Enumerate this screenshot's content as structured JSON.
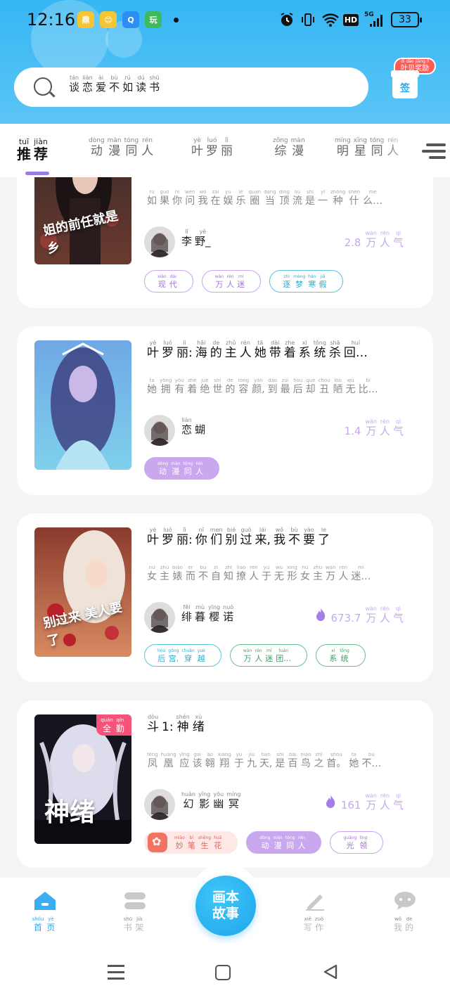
{
  "status_bar": {
    "time": "12:16",
    "apps": [
      {
        "icon": "xiaomi-app-icon",
        "label": "鼎",
        "color": "#f5c533"
      },
      {
        "icon": "emoji-app-icon",
        "label": "😊",
        "color": "#f5c533"
      },
      {
        "icon": "qq-browser-icon",
        "label": "Q",
        "color": "#2c8df3"
      },
      {
        "icon": "game-app-icon",
        "label": "玩",
        "color": "#3dbb5c"
      }
    ],
    "network_label": "HD",
    "signal_label": "5G",
    "battery": "33"
  },
  "search": {
    "placeholder": [
      {
        "p": "tán",
        "c": "谈"
      },
      {
        "p": "liàn",
        "c": "恋"
      },
      {
        "p": "ài",
        "c": "爱"
      },
      {
        "p": "bù",
        "c": "不"
      },
      {
        "p": "rú",
        "c": "如"
      },
      {
        "p": "dú",
        "c": "读"
      },
      {
        "p": "shū",
        "c": "书"
      }
    ]
  },
  "sign_in": {
    "badge": [
      {
        "p": "yè",
        "c": "叶"
      },
      {
        "p": "luó",
        "c": "罗"
      },
      {
        "p": "lì",
        "c": "丽"
      },
      {
        "p": "dì",
        "c": "?"
      }
    ],
    "badge_text": "叶贝奖励",
    "badge_pinyin": "dì dǎo jiǎng lì",
    "label": "签"
  },
  "tabs": [
    {
      "name": "tab-recommend",
      "active": true,
      "chars": [
        {
          "p": "tuī",
          "c": "推"
        },
        {
          "p": "jiàn",
          "c": "荐"
        }
      ]
    },
    {
      "name": "tab-anime-fan",
      "active": false,
      "chars": [
        {
          "p": "dòng",
          "c": "动"
        },
        {
          "p": "màn",
          "c": "漫"
        },
        {
          "p": "tóng",
          "c": "同"
        },
        {
          "p": "rén",
          "c": "人"
        }
      ]
    },
    {
      "name": "tab-yeluoli",
      "active": false,
      "chars": [
        {
          "p": "yè",
          "c": "叶"
        },
        {
          "p": "luó",
          "c": "罗"
        },
        {
          "p": "lì",
          "c": "丽"
        }
      ]
    },
    {
      "name": "tab-variety",
      "active": false,
      "chars": [
        {
          "p": "zōng",
          "c": "综"
        },
        {
          "p": "màn",
          "c": "漫"
        }
      ]
    },
    {
      "name": "tab-star-fan",
      "active": false,
      "chars": [
        {
          "p": "míng",
          "c": "明"
        },
        {
          "p": "xīng",
          "c": "星"
        },
        {
          "p": "tóng",
          "c": "同"
        },
        {
          "p": "rén",
          "c": "人"
        }
      ]
    }
  ],
  "stories": [
    {
      "cover_text": "姐的前任就是乡",
      "title": [],
      "desc": [
        {
          "p": "rú",
          "c": "如"
        },
        {
          "p": "guǒ",
          "c": "果"
        },
        {
          "p": "nǐ",
          "c": "你"
        },
        {
          "p": "wèn",
          "c": "问"
        },
        {
          "p": "wǒ",
          "c": "我"
        },
        {
          "p": "zài",
          "c": "在"
        },
        {
          "p": "yú",
          "c": "娱"
        },
        {
          "p": "lè",
          "c": "乐"
        },
        {
          "p": "quān",
          "c": "圈"
        },
        {
          "p": "dāng",
          "c": "当"
        },
        {
          "p": "dǐng",
          "c": "顶"
        },
        {
          "p": "liú",
          "c": "流"
        },
        {
          "p": "shì",
          "c": "是"
        },
        {
          "p": "yī",
          "c": "一"
        },
        {
          "p": "zhǒng",
          "c": "种"
        },
        {
          "p": "shén",
          "c": "什"
        },
        {
          "p": "me",
          "c": "么…"
        }
      ],
      "author": [
        {
          "p": "lǐ",
          "c": "李"
        },
        {
          "p": "yě",
          "c": "野_"
        }
      ],
      "heat_num": "2.8",
      "heat_unit": [
        {
          "p": "wàn",
          "c": "万"
        },
        {
          "p": "rén",
          "c": "人"
        },
        {
          "p": "qì",
          "c": "气"
        }
      ],
      "hot": false,
      "chips": [
        {
          "style": "purple",
          "chars": [
            {
              "p": "xiàn",
              "c": "现"
            },
            {
              "p": "dài",
              "c": "代"
            }
          ]
        },
        {
          "style": "purple",
          "chars": [
            {
              "p": "wàn",
              "c": "万"
            },
            {
              "p": "rén",
              "c": "人"
            },
            {
              "p": "mí",
              "c": "迷"
            }
          ]
        },
        {
          "style": "cyan",
          "chars": [
            {
              "p": "zhì",
              "c": "逐"
            },
            {
              "p": "mèng",
              "c": "梦"
            },
            {
              "p": "hán",
              "c": "寒"
            },
            {
              "p": "jiǎ",
              "c": "假"
            }
          ]
        }
      ]
    },
    {
      "cover_text": "",
      "title": [
        {
          "p": "yè",
          "c": "叶"
        },
        {
          "p": "luó",
          "c": "罗"
        },
        {
          "p": "lì",
          "c": "丽:"
        },
        {
          "p": "hǎi",
          "c": "海"
        },
        {
          "p": "de",
          "c": "的"
        },
        {
          "p": "zhǔ",
          "c": "主"
        },
        {
          "p": "rén",
          "c": "人"
        },
        {
          "p": "tā",
          "c": "她"
        },
        {
          "p": "dài",
          "c": "带"
        },
        {
          "p": "zhe",
          "c": "着"
        },
        {
          "p": "xì",
          "c": "系"
        },
        {
          "p": "tǒng",
          "c": "统"
        },
        {
          "p": "shā",
          "c": "杀"
        },
        {
          "p": "huí",
          "c": "回…"
        }
      ],
      "desc": [
        {
          "p": "tā",
          "c": "她"
        },
        {
          "p": "yōng",
          "c": "拥"
        },
        {
          "p": "yǒu",
          "c": "有"
        },
        {
          "p": "zhe",
          "c": "着"
        },
        {
          "p": "jué",
          "c": "绝"
        },
        {
          "p": "shì",
          "c": "世"
        },
        {
          "p": "de",
          "c": "的"
        },
        {
          "p": "róng",
          "c": "容"
        },
        {
          "p": "yán",
          "c": "颜,"
        },
        {
          "p": "dào",
          "c": "到"
        },
        {
          "p": "zuì",
          "c": "最"
        },
        {
          "p": "hòu",
          "c": "后"
        },
        {
          "p": "què",
          "c": "却"
        },
        {
          "p": "chǒu",
          "c": "丑"
        },
        {
          "p": "lòu",
          "c": "陋"
        },
        {
          "p": "wú",
          "c": "无"
        },
        {
          "p": "bǐ",
          "c": "比…"
        }
      ],
      "author": [
        {
          "p": "liàn",
          "c": "恋"
        },
        {
          "p": "",
          "c": "蝴"
        }
      ],
      "heat_num": "1.4",
      "heat_unit": [
        {
          "p": "wàn",
          "c": "万"
        },
        {
          "p": "rén",
          "c": "人"
        },
        {
          "p": "qì",
          "c": "气"
        }
      ],
      "hot": false,
      "chips": [
        {
          "style": "solid-purple",
          "chars": [
            {
              "p": "dòng",
              "c": "动"
            },
            {
              "p": "màn",
              "c": "漫"
            },
            {
              "p": "tóng",
              "c": "同"
            },
            {
              "p": "rén",
              "c": "人"
            }
          ]
        }
      ]
    },
    {
      "cover_text": "别过来 美人要了",
      "title": [
        {
          "p": "yè",
          "c": "叶"
        },
        {
          "p": "luó",
          "c": "罗"
        },
        {
          "p": "lì",
          "c": "丽:"
        },
        {
          "p": "nǐ",
          "c": "你"
        },
        {
          "p": "men",
          "c": "们"
        },
        {
          "p": "bié",
          "c": "别"
        },
        {
          "p": "guò",
          "c": "过"
        },
        {
          "p": "lái",
          "c": "来,"
        },
        {
          "p": "wǒ",
          "c": "我"
        },
        {
          "p": "bù",
          "c": "不"
        },
        {
          "p": "yào",
          "c": "要"
        },
        {
          "p": "le",
          "c": "了"
        }
      ],
      "desc": [
        {
          "p": "nǚ",
          "c": "女"
        },
        {
          "p": "zhǔ",
          "c": "主"
        },
        {
          "p": "biǎo",
          "c": "婊"
        },
        {
          "p": "ér",
          "c": "而"
        },
        {
          "p": "bù",
          "c": "不"
        },
        {
          "p": "zì",
          "c": "自"
        },
        {
          "p": "zhī",
          "c": "知"
        },
        {
          "p": "liáo",
          "c": "撩"
        },
        {
          "p": "rén",
          "c": "人"
        },
        {
          "p": "yú",
          "c": "于"
        },
        {
          "p": "wú",
          "c": "无"
        },
        {
          "p": "xíng",
          "c": "形"
        },
        {
          "p": "nǚ",
          "c": "女"
        },
        {
          "p": "zhǔ",
          "c": "主"
        },
        {
          "p": "wàn",
          "c": "万"
        },
        {
          "p": "rén",
          "c": "人"
        },
        {
          "p": "mí",
          "c": "迷…"
        }
      ],
      "author": [
        {
          "p": "fēi",
          "c": "绯"
        },
        {
          "p": "mù",
          "c": "暮"
        },
        {
          "p": "yīng",
          "c": "樱"
        },
        {
          "p": "nuò",
          "c": "诺"
        }
      ],
      "heat_num": "673.7",
      "heat_unit": [
        {
          "p": "wàn",
          "c": "万"
        },
        {
          "p": "rén",
          "c": "人"
        },
        {
          "p": "qì",
          "c": "气"
        }
      ],
      "hot": true,
      "chips": [
        {
          "style": "cyan",
          "chars": [
            {
              "p": "hòu",
              "c": "后"
            },
            {
              "p": "gōng",
              "c": "宫,"
            },
            {
              "p": "chuān",
              "c": "穿"
            },
            {
              "p": "yuè",
              "c": "越"
            }
          ]
        },
        {
          "style": "green",
          "chars": [
            {
              "p": "wàn",
              "c": "万"
            },
            {
              "p": "rén",
              "c": "人"
            },
            {
              "p": "mí",
              "c": "迷"
            },
            {
              "p": "tuán",
              "c": "团…"
            }
          ]
        },
        {
          "style": "green",
          "chars": [
            {
              "p": "xì",
              "c": "系"
            },
            {
              "p": "tǒng",
              "c": "统"
            }
          ]
        }
      ]
    },
    {
      "cover_text": "神绪",
      "cover_tag": [
        {
          "p": "quán",
          "c": "全"
        },
        {
          "p": "qín",
          "c": "勤"
        }
      ],
      "title": [
        {
          "p": "dòu",
          "c": "斗"
        },
        {
          "p": "",
          "c": "1:"
        },
        {
          "p": "shén",
          "c": "神"
        },
        {
          "p": "xù",
          "c": "绪"
        }
      ],
      "desc": [
        {
          "p": "fèng",
          "c": "凤"
        },
        {
          "p": "huáng",
          "c": "凰"
        },
        {
          "p": "yīng",
          "c": "应"
        },
        {
          "p": "gāi",
          "c": "该"
        },
        {
          "p": "áo",
          "c": "翱"
        },
        {
          "p": "xiáng",
          "c": "翔"
        },
        {
          "p": "yú",
          "c": "于"
        },
        {
          "p": "jiǔ",
          "c": "九"
        },
        {
          "p": "tiān",
          "c": "天,"
        },
        {
          "p": "shì",
          "c": "是"
        },
        {
          "p": "bǎi",
          "c": "百"
        },
        {
          "p": "niǎo",
          "c": "鸟"
        },
        {
          "p": "zhī",
          "c": "之"
        },
        {
          "p": "shǒu",
          "c": "首。"
        },
        {
          "p": "tā",
          "c": "她"
        },
        {
          "p": "bù",
          "c": "不…"
        }
      ],
      "author": [
        {
          "p": "huàn",
          "c": "幻"
        },
        {
          "p": "yǐng",
          "c": "影"
        },
        {
          "p": "yōu",
          "c": "幽"
        },
        {
          "p": "míng",
          "c": "冥"
        }
      ],
      "heat_num": "161",
      "heat_unit": [
        {
          "p": "wàn",
          "c": "万"
        },
        {
          "p": "rén",
          "c": "人"
        },
        {
          "p": "qì",
          "c": "气"
        }
      ],
      "hot": true,
      "chips": [
        {
          "style": "pink",
          "chars": [
            {
              "p": "miào",
              "c": "妙"
            },
            {
              "p": "bǐ",
              "c": "笔"
            },
            {
              "p": "shēng",
              "c": "生"
            },
            {
              "p": "huā",
              "c": "花"
            }
          ]
        },
        {
          "style": "solid-purple",
          "chars": [
            {
              "p": "dòng",
              "c": "动"
            },
            {
              "p": "màn",
              "c": "漫"
            },
            {
              "p": "tóng",
              "c": "同"
            },
            {
              "p": "rén",
              "c": "人"
            }
          ]
        },
        {
          "style": "purple",
          "chars": [
            {
              "p": "guāng",
              "c": "光"
            },
            {
              "p": "líng",
              "c": "领"
            }
          ]
        }
      ]
    }
  ],
  "bottom_nav": [
    {
      "name": "nav-home",
      "active": true,
      "icon": "home-icon",
      "chars": [
        {
          "p": "shǒu",
          "c": "首"
        },
        {
          "p": "yè",
          "c": "页"
        }
      ]
    },
    {
      "name": "nav-bookshelf",
      "active": false,
      "icon": "bookshelf-icon",
      "chars": [
        {
          "p": "shū",
          "c": "书"
        },
        {
          "p": "jià",
          "c": "架"
        }
      ]
    },
    {
      "name": "nav-write",
      "active": false,
      "icon": "pen-icon",
      "chars": [
        {
          "p": "xiě",
          "c": "写"
        },
        {
          "p": "zuò",
          "c": "作"
        }
      ]
    },
    {
      "name": "nav-mine",
      "active": false,
      "icon": "chat-bubble-icon",
      "chars": [
        {
          "p": "wǒ",
          "c": "我"
        },
        {
          "p": "de",
          "c": "的"
        }
      ]
    }
  ],
  "center_button": {
    "line1": "画本",
    "line2": "故事"
  },
  "colors": {
    "header": "#35b6f3",
    "accent": "#2fa8ef",
    "tab_indicator": "#9b7be6",
    "heat": "#c7a8f0"
  }
}
